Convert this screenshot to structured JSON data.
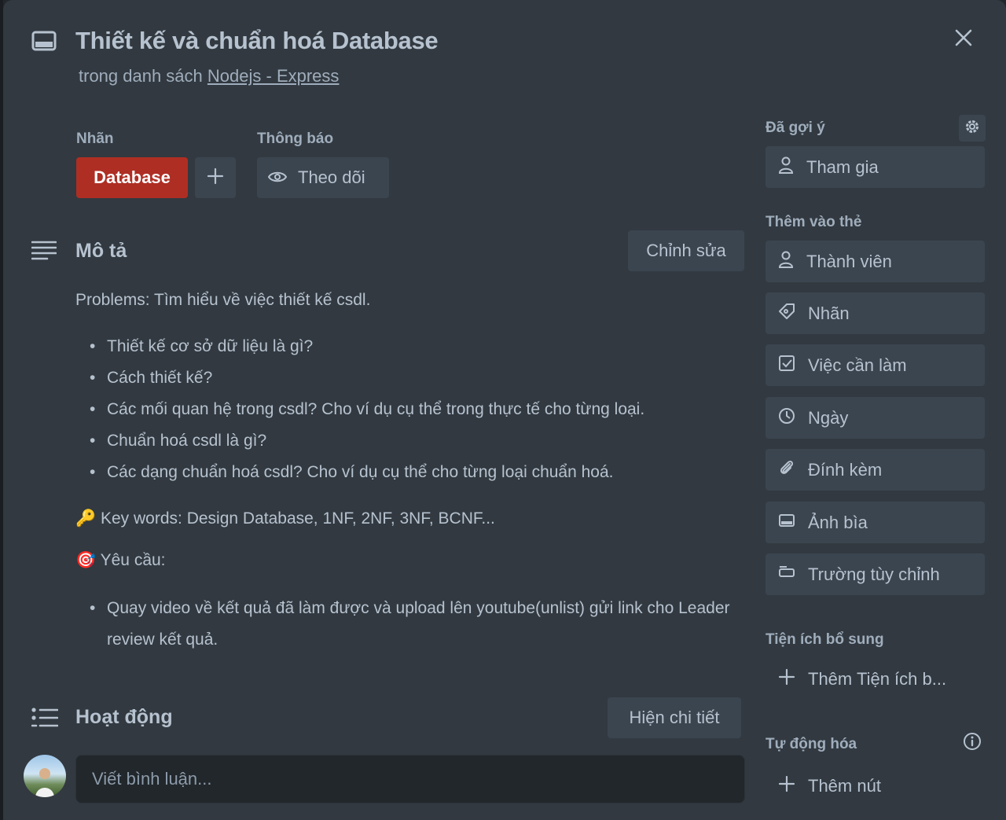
{
  "card": {
    "title": "Thiết kế và chuẩn hoá Database",
    "list_prefix": "trong danh sách",
    "list_name": "Nodejs - Express"
  },
  "labels": {
    "heading": "Nhãn",
    "chip": "Database",
    "chip_color": "#ae2e24"
  },
  "notifications": {
    "heading": "Thông báo",
    "watch_label": "Theo dõi"
  },
  "description": {
    "heading": "Mô tả",
    "edit_label": "Chỉnh sửa",
    "intro": "Problems: Tìm hiểu về việc thiết kế csdl.",
    "bullets": [
      "Thiết kế cơ sở dữ liệu là gì?",
      "Cách thiết kế?",
      "Các mối quan hệ trong csdl? Cho ví dụ cụ thể trong thực tế cho từng loại.",
      "Chuẩn hoá csdl là gì?",
      "Các dạng chuẩn hoá csdl? Cho ví dụ cụ thể cho từng loại chuẩn hoá."
    ],
    "keywords_emoji": "🔑",
    "keywords": "Key words: Design Database, 1NF, 2NF, 3NF, BCNF...",
    "requirements_emoji": "🎯",
    "requirements": "Yêu cầu:",
    "requirement_items": [
      "Quay video về kết quả đã làm được và upload lên youtube(unlist) gửi link cho Leader review kết quả."
    ]
  },
  "activity": {
    "heading": "Hoạt động",
    "details_label": "Hiện chi tiết",
    "comment_placeholder": "Viết bình luận..."
  },
  "sidebar": {
    "suggested_heading": "Đã gợi ý",
    "join_label": "Tham gia",
    "add_heading": "Thêm vào thẻ",
    "add_items": [
      {
        "label": "Thành viên",
        "icon": "user-icon"
      },
      {
        "label": "Nhãn",
        "icon": "tag-icon"
      },
      {
        "label": "Việc cần làm",
        "icon": "checklist-icon"
      },
      {
        "label": "Ngày",
        "icon": "clock-icon"
      },
      {
        "label": "Đính kèm",
        "icon": "paperclip-icon"
      },
      {
        "label": "Ảnh bìa",
        "icon": "cover-icon"
      },
      {
        "label": "Trường tùy chỉnh",
        "icon": "custom-field-icon"
      }
    ],
    "powerups_heading": "Tiện ích bổ sung",
    "add_powerup_label": "Thêm Tiện ích b...",
    "automation_heading": "Tự động hóa",
    "add_button_label": "Thêm nút"
  }
}
